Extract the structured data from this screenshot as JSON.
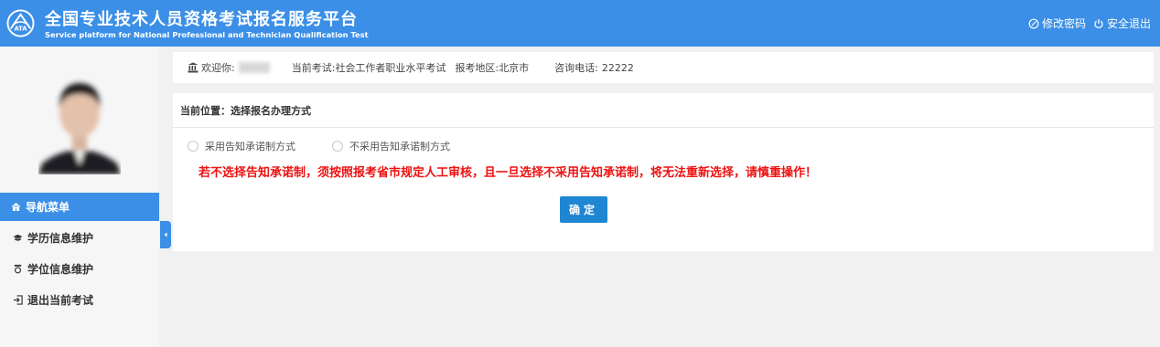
{
  "header": {
    "title": "全国专业技术人员资格考试报名服务平台",
    "subtitle": "Service platform for National Professional and Technician Qualification Test",
    "logo_text": "ATA",
    "change_password": "修改密码",
    "logout": "安全退出"
  },
  "sidebar": {
    "nav_title": "导航菜单",
    "items": [
      {
        "label": "学历信息维护",
        "icon": "graduation-cap-icon"
      },
      {
        "label": "学位信息维护",
        "icon": "medal-icon"
      },
      {
        "label": "退出当前考试",
        "icon": "sign-out-icon"
      }
    ]
  },
  "info": {
    "welcome": "欢迎你:",
    "current_exam_label": "当前考试:",
    "current_exam": "社会工作者职业水平考试",
    "region_label": "报考地区:",
    "region": "北京市",
    "phone_label": "咨询电话:",
    "phone": "22222"
  },
  "main": {
    "breadcrumb": "当前位置：选择报名办理方式",
    "options": [
      "采用告知承诺制方式",
      "不采用告知承诺制方式"
    ],
    "warning": "若不选择告知承诺制，须按照报考省市规定人工审核，且一旦选择不采用告知承诺制，将无法重新选择，请慎重操作！",
    "confirm": "确定"
  },
  "colors": {
    "primary": "#3b8fe6",
    "button": "#1f86d2",
    "warning": "#ee1111"
  }
}
